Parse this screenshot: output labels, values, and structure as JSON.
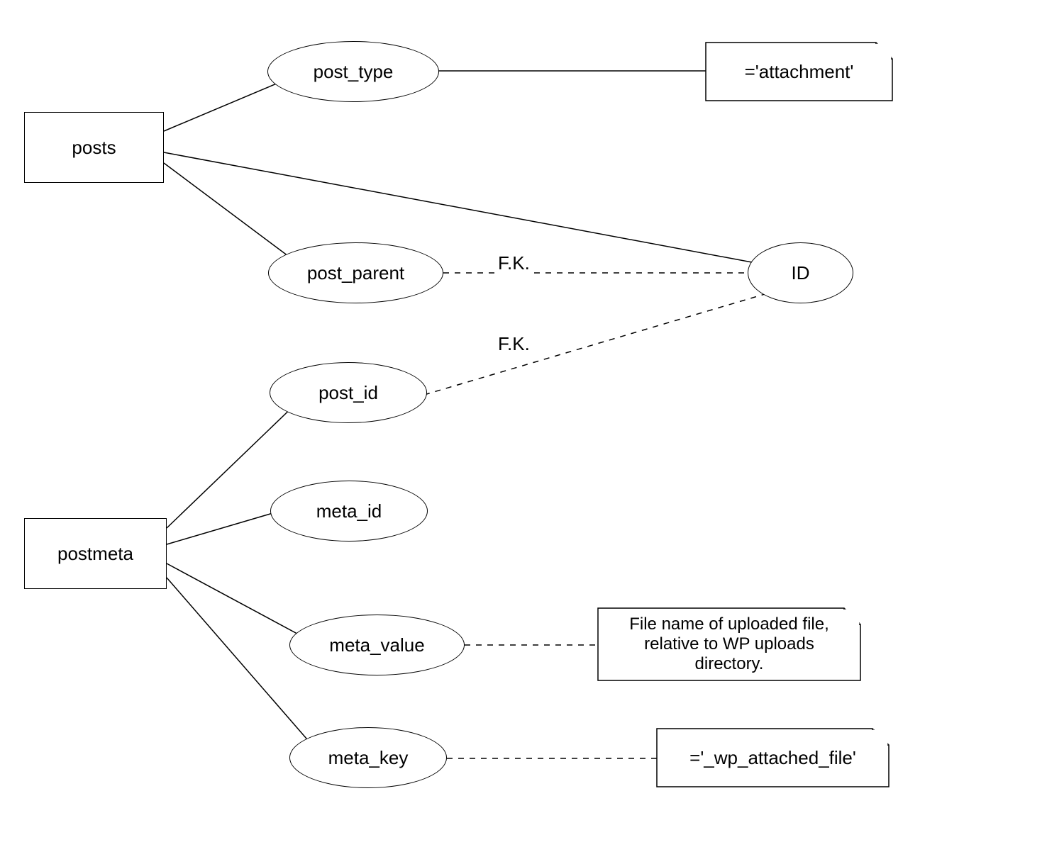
{
  "entities": {
    "posts": "posts",
    "postmeta": "postmeta"
  },
  "attributes": {
    "post_type": "post_type",
    "post_parent": "post_parent",
    "id": "ID",
    "post_id": "post_id",
    "meta_id": "meta_id",
    "meta_value": "meta_value",
    "meta_key": "meta_key"
  },
  "notes": {
    "attachment": "='attachment'",
    "filename": "File name of uploaded file, relative to WP uploads directory.",
    "wpattached": "='_wp_attached_file'"
  },
  "relations": {
    "fk1": "F.K.",
    "fk2": "F.K."
  }
}
